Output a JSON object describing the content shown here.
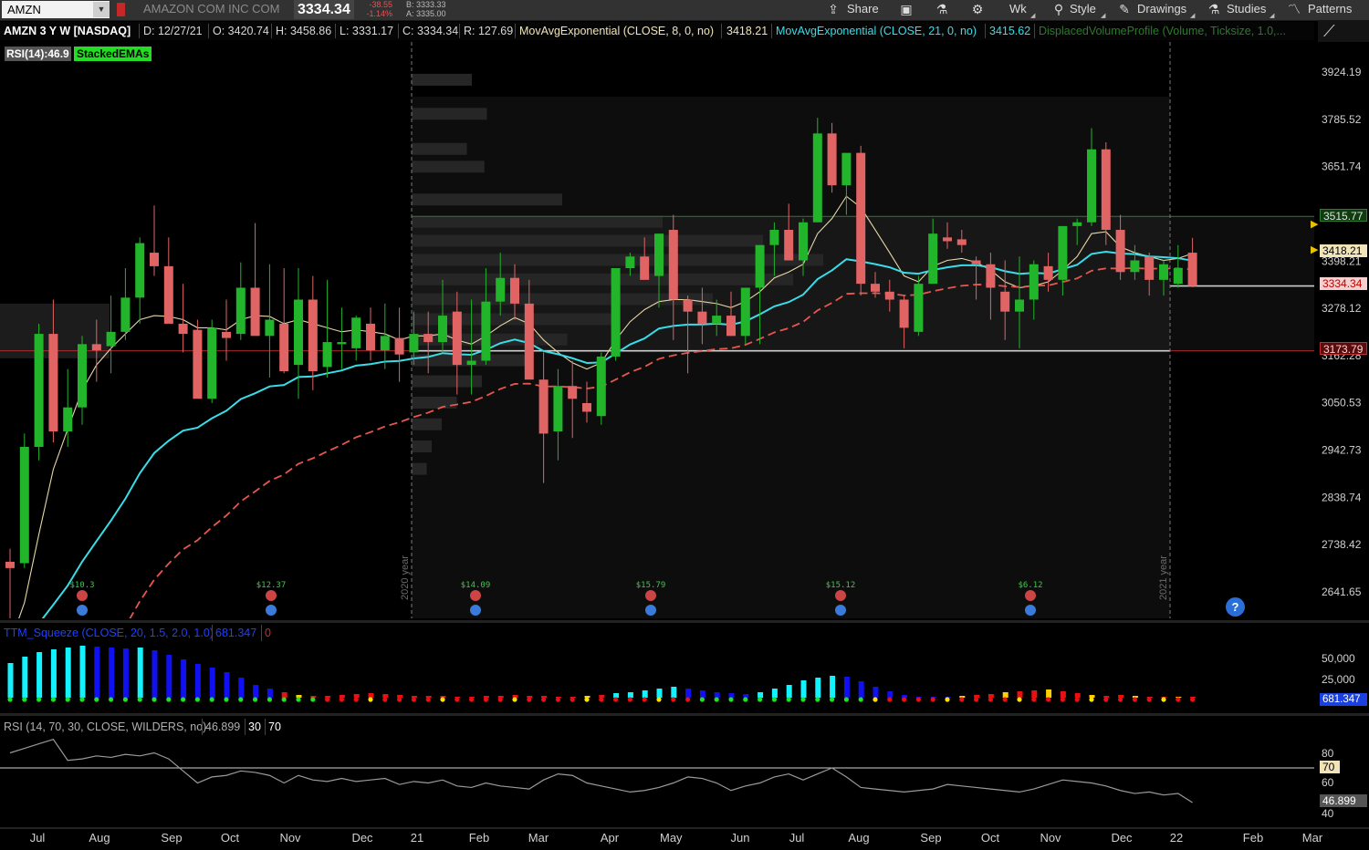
{
  "toolbar": {
    "symbol": "AMZN",
    "company": "AMAZON COM INC COM",
    "last": "3334.34",
    "change": "-38.55",
    "change_pct": "-1.14%",
    "bid": "B: 3333.33",
    "ask": "A: 3335.00",
    "share": "Share",
    "timeframe": "Wk",
    "style": "Style",
    "drawings": "Drawings",
    "studies": "Studies",
    "patterns": "Patterns"
  },
  "header": {
    "title": "AMZN 3 Y W [NASDAQ]",
    "date": "D: 12/27/21",
    "open": "O: 3420.74",
    "high": "H: 3458.86",
    "low": "L: 3331.17",
    "close": "C: 3334.34",
    "range": "R: 127.69",
    "ema8_label": "MovAvgExponential (CLOSE, 8, 0, no)",
    "ema8_value": "3418.21",
    "ema21_label": "MovAvgExponential (CLOSE, 21, 0, no)",
    "ema21_value": "3415.62",
    "dvp_label": "DisplacedVolumeProfile (Volume, Ticksize, 1.0,...",
    "rsi_badge": "RSI(14):46.9",
    "stacked_badge": "StackedEMAs"
  },
  "colors": {
    "up": "#22b42a",
    "down": "#e06464",
    "ema8": "#e8d6a6",
    "ema21": "#38dde8",
    "ema_slow": "#e8564e",
    "rsi_line": "#9a9a9a",
    "squeeze_cyan": "#12f2ff",
    "squeeze_blue": "#1010f0"
  },
  "chart_data": [
    {
      "type": "candlestick",
      "title": "AMZN 3 Y W [NASDAQ]",
      "y_ticks": [
        3924.19,
        3785.52,
        3651.74,
        3398.21,
        3278.12,
        3162.28,
        3050.53,
        2942.73,
        2838.74,
        2738.42,
        2641.65
      ],
      "price_tags": [
        "3515.77",
        "3418.21",
        "3334.34",
        "3173.79"
      ],
      "x_labels": [
        "Jul",
        "Aug",
        "Sep",
        "Oct",
        "Nov",
        "Dec",
        "21",
        "Feb",
        "Mar",
        "Apr",
        "May",
        "Jun",
        "Jul",
        "Aug",
        "Sep",
        "Oct",
        "Nov",
        "Dec",
        "22",
        "Feb",
        "Mar"
      ],
      "year_markers": [
        "2020 year",
        "2021 year"
      ],
      "dividends": [
        "$10.3",
        "$12.37",
        "$14.09",
        "$15.79",
        "$15.12",
        "$6.12"
      ],
      "candles": [
        [
          2703,
          2730,
          2550,
          2690
        ],
        [
          2700,
          2980,
          2690,
          2950
        ],
        [
          2950,
          3240,
          2920,
          3215
        ],
        [
          3215,
          3300,
          2960,
          2985
        ],
        [
          2985,
          3130,
          2950,
          3040
        ],
        [
          3040,
          3210,
          3000,
          3190
        ],
        [
          3190,
          3250,
          3100,
          3175
        ],
        [
          3185,
          3310,
          3120,
          3220
        ],
        [
          3220,
          3380,
          3200,
          3305
        ],
        [
          3305,
          3460,
          3240,
          3445
        ],
        [
          3420,
          3545,
          3360,
          3385
        ],
        [
          3385,
          3460,
          3280,
          3240
        ],
        [
          3240,
          3340,
          3170,
          3215
        ],
        [
          3225,
          3250,
          3090,
          3060
        ],
        [
          3060,
          3250,
          3050,
          3230
        ],
        [
          3220,
          3300,
          3150,
          3205
        ],
        [
          3215,
          3395,
          3200,
          3330
        ],
        [
          3330,
          3498,
          3260,
          3210
        ],
        [
          3210,
          3390,
          3110,
          3250
        ],
        [
          3240,
          3380,
          3120,
          3125
        ],
        [
          3140,
          3380,
          3060,
          3300
        ],
        [
          3300,
          3360,
          3080,
          3125
        ],
        [
          3135,
          3350,
          3110,
          3195
        ],
        [
          3190,
          3280,
          3130,
          3195
        ],
        [
          3180,
          3260,
          3150,
          3255
        ],
        [
          3240,
          3280,
          3150,
          3175
        ],
        [
          3175,
          3290,
          3130,
          3210
        ],
        [
          3205,
          3280,
          3100,
          3165
        ],
        [
          3170,
          3270,
          3140,
          3215
        ],
        [
          3215,
          3270,
          3120,
          3195
        ],
        [
          3195,
          3350,
          3170,
          3260
        ],
        [
          3270,
          3320,
          3070,
          3140
        ],
        [
          3140,
          3300,
          3070,
          3150
        ],
        [
          3150,
          3380,
          3140,
          3295
        ],
        [
          3295,
          3420,
          3260,
          3355
        ],
        [
          3355,
          3390,
          3250,
          3290
        ],
        [
          3290,
          3350,
          3170,
          3105
        ],
        [
          3105,
          3170,
          2870,
          2980
        ],
        [
          2985,
          3130,
          2920,
          3090
        ],
        [
          3090,
          3150,
          2970,
          3060
        ],
        [
          3050,
          3100,
          3005,
          3030
        ],
        [
          3020,
          3170,
          3000,
          3160
        ],
        [
          3160,
          3370,
          3150,
          3380
        ],
        [
          3380,
          3420,
          3360,
          3410
        ],
        [
          3410,
          3460,
          3370,
          3350
        ],
        [
          3360,
          3470,
          3280,
          3470
        ],
        [
          3480,
          3520,
          3200,
          3300
        ],
        [
          3300,
          3310,
          3120,
          3270
        ],
        [
          3270,
          3330,
          3190,
          3240
        ],
        [
          3240,
          3300,
          3210,
          3260
        ],
        [
          3260,
          3320,
          3210,
          3210
        ],
        [
          3210,
          3300,
          3190,
          3330
        ],
        [
          3330,
          3390,
          3190,
          3440
        ],
        [
          3440,
          3500,
          3360,
          3480
        ],
        [
          3480,
          3550,
          3440,
          3400
        ],
        [
          3400,
          3510,
          3360,
          3500
        ],
        [
          3500,
          3790,
          3500,
          3745
        ],
        [
          3745,
          3775,
          3580,
          3600
        ],
        [
          3600,
          3610,
          3520,
          3690
        ],
        [
          3690,
          3710,
          3310,
          3340
        ],
        [
          3340,
          3370,
          3305,
          3320
        ],
        [
          3320,
          3350,
          3270,
          3300
        ],
        [
          3300,
          3310,
          3180,
          3230
        ],
        [
          3220,
          3360,
          3210,
          3340
        ],
        [
          3340,
          3510,
          3340,
          3470
        ],
        [
          3460,
          3500,
          3430,
          3450
        ],
        [
          3455,
          3480,
          3420,
          3440
        ],
        [
          3400,
          3410,
          3300,
          3390
        ],
        [
          3390,
          3420,
          3250,
          3330
        ],
        [
          3320,
          3400,
          3200,
          3270
        ],
        [
          3270,
          3410,
          3180,
          3300
        ],
        [
          3300,
          3400,
          3250,
          3390
        ],
        [
          3385,
          3420,
          3320,
          3350
        ],
        [
          3350,
          3430,
          3310,
          3490
        ],
        [
          3490,
          3510,
          3440,
          3500
        ],
        [
          3500,
          3760,
          3490,
          3700
        ],
        [
          3700,
          3720,
          3440,
          3480
        ],
        [
          3480,
          3520,
          3350,
          3370
        ],
        [
          3370,
          3440,
          3350,
          3400
        ],
        [
          3410,
          3420,
          3310,
          3350
        ],
        [
          3350,
          3400,
          3310,
          3390
        ],
        [
          3340,
          3440,
          3330,
          3380
        ],
        [
          3420,
          3458.86,
          3331.17,
          3334.34
        ]
      ],
      "ema8": [
        2540,
        2620,
        2760,
        2900,
        2990,
        3080,
        3140,
        3180,
        3215,
        3250,
        3260,
        3258,
        3250,
        3230,
        3230,
        3225,
        3250,
        3260,
        3258,
        3240,
        3250,
        3240,
        3230,
        3220,
        3225,
        3220,
        3215,
        3200,
        3210,
        3210,
        3215,
        3200,
        3190,
        3210,
        3235,
        3255,
        3240,
        3200,
        3170,
        3145,
        3130,
        3145,
        3200,
        3245,
        3275,
        3295,
        3300,
        3300,
        3295,
        3290,
        3280,
        3295,
        3320,
        3355,
        3370,
        3390,
        3470,
        3510,
        3570,
        3540,
        3480,
        3420,
        3360,
        3345,
        3385,
        3400,
        3405,
        3395,
        3375,
        3345,
        3330,
        3335,
        3345,
        3375,
        3410,
        3470,
        3475,
        3435,
        3420,
        3410,
        3400,
        3405,
        3418
      ]
    },
    {
      "type": "bar",
      "title": "TTM_Squeeze (CLOSE, 20, 1.5, 2.0, 1.0)",
      "legend": [
        "681.347",
        "0"
      ],
      "y_ticks": [
        "50,000",
        "25,000"
      ],
      "value_tag": "681.347"
    },
    {
      "type": "line",
      "title": "RSI (14, 70, 30, CLOSE, WILDERS, no)",
      "legend": [
        "46.899",
        "30",
        "70"
      ],
      "y_ticks": [
        "80",
        "60",
        "40"
      ],
      "level_tag": "70",
      "value_tag": "46.899",
      "values": [
        80,
        83,
        86,
        89,
        75,
        76,
        78,
        77,
        79,
        78,
        80,
        76,
        68,
        60,
        64,
        65,
        68,
        67,
        65,
        60,
        65,
        62,
        61,
        63,
        61,
        62,
        63,
        59,
        61,
        60,
        62,
        58,
        57,
        60,
        58,
        57,
        56,
        62,
        66,
        65,
        60,
        58,
        56,
        54,
        55,
        57,
        60,
        64,
        63,
        60,
        55,
        58,
        60,
        64,
        66,
        62,
        66,
        70,
        64,
        57,
        56,
        55,
        54,
        55,
        56,
        59,
        58,
        57,
        56,
        55,
        54,
        56,
        59,
        62,
        61,
        60,
        58,
        55,
        53,
        54,
        52,
        53,
        47
      ]
    }
  ],
  "help_icon": "?"
}
